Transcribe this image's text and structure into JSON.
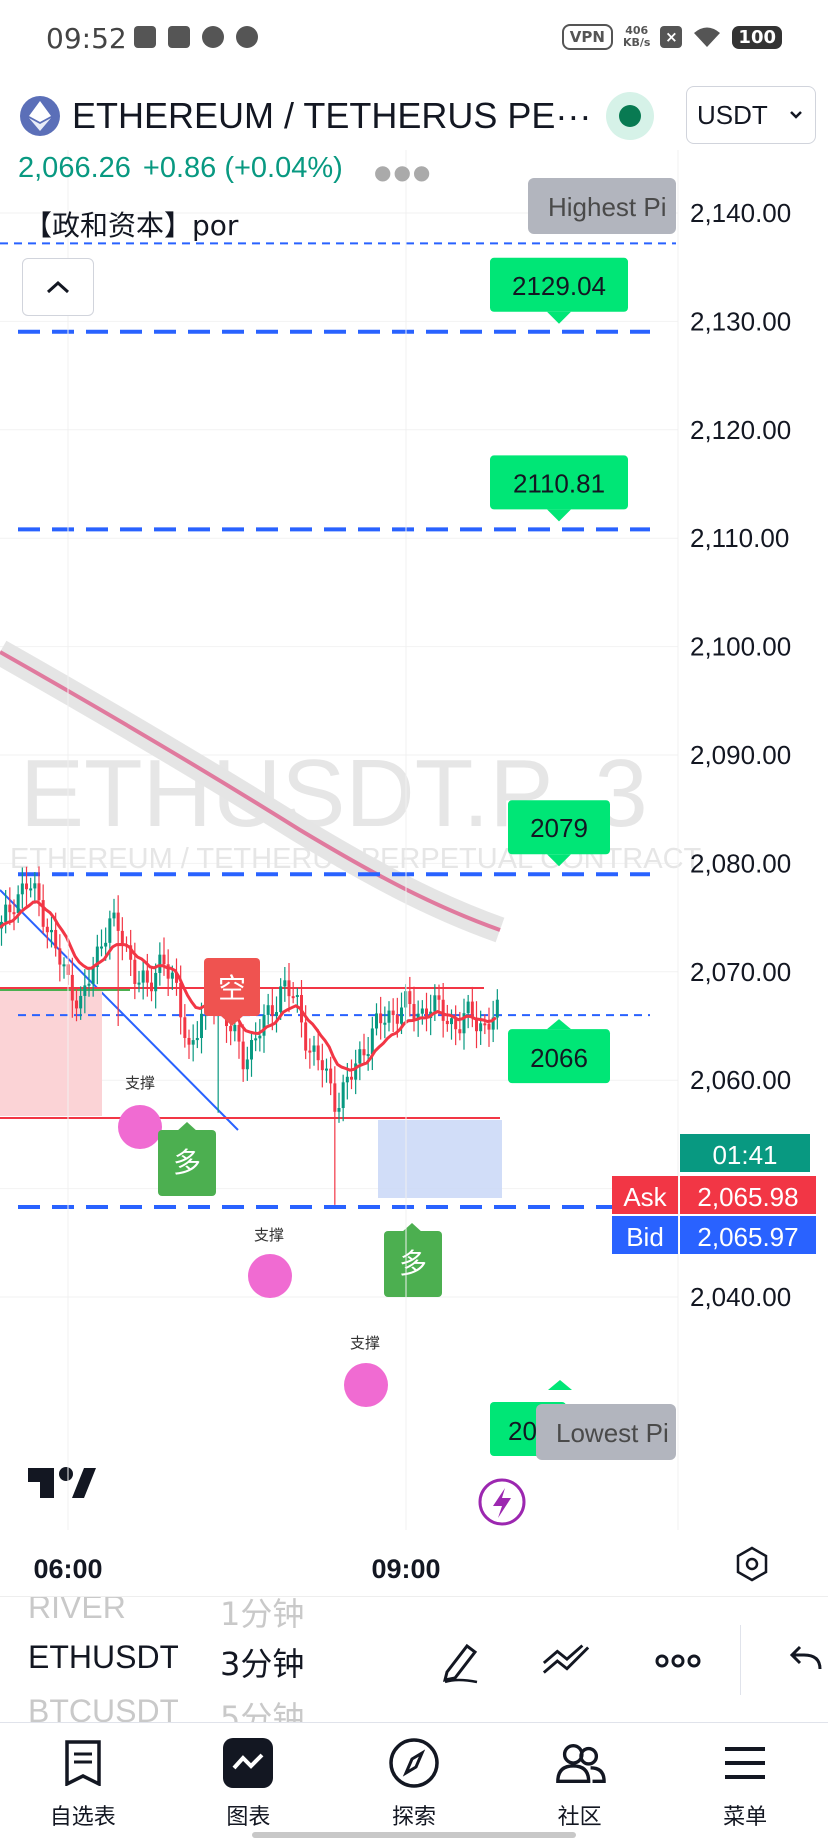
{
  "status_bar": {
    "time": "09:52",
    "vpn": "VPN",
    "net_speed_value": "406",
    "net_speed_unit": "KB/s",
    "battery": "100"
  },
  "header": {
    "symbol_title": "ETHEREUM / TETHERUS PE···",
    "currency": "USDT",
    "last_price": "2,066.26",
    "change": "+0.86 (+0.04%)",
    "indicator_label": "【政和资本】por"
  },
  "colors": {
    "up": "#089981",
    "down": "#f23645",
    "level_tag": "#00e676",
    "dashed_level": "#2962ff",
    "pink_marker": "#f06bd2",
    "long_tag": "#4caf50",
    "short_tag": "#ef5350"
  },
  "chart": {
    "watermark_symbol": "ETHUSDT.P, 3",
    "watermark_description": "ETHEREUM / TETHERUS PERPETUAL CONTRACT",
    "highest_label": "Highest Pi",
    "lowest_label": "Lowest Pi",
    "countdown": "01:41",
    "ask_label": "Ask",
    "ask_value": "2,065.98",
    "bid_label": "Bid",
    "bid_value": "2,065.97",
    "support_label": "支撑",
    "long_label": "多",
    "short_label": "空",
    "partial_low_tag": "20",
    "level_tags": [
      {
        "text": "2129.04",
        "value": 2129.04
      },
      {
        "text": "2110.81",
        "value": 2110.81
      },
      {
        "text": "2079",
        "value": 2079
      },
      {
        "text": "2066",
        "value": 2066
      }
    ],
    "time_labels": [
      "06:00",
      "09:00"
    ]
  },
  "chart_data": {
    "type": "candlestick",
    "title": "ETHUSDT.P, 3",
    "y_ticks": [
      2140,
      2130,
      2120,
      2110,
      2100,
      2090,
      2080,
      2070,
      2060,
      2050,
      2040
    ],
    "y_tick_labels": [
      "2,140.00",
      "2,130.00",
      "2,120.00",
      "2,110.00",
      "2,100.00",
      "2,090.00",
      "2,080.00",
      "2,070.00",
      "2,060.00",
      "2,050.00",
      "2,040.00"
    ],
    "ylim": [
      2038,
      2151
    ],
    "dashed_levels": [
      2137.2,
      2129.04,
      2110.81,
      2079,
      2066,
      2048.3
    ],
    "x_labels": [
      "06:00",
      "09:00"
    ],
    "close_path": [
      2074,
      2077,
      2078,
      2076,
      2072,
      2069,
      2067,
      2071,
      2075,
      2073,
      2070,
      2068,
      2072,
      2068,
      2063,
      2066,
      2068,
      2065,
      2062,
      2064,
      2066,
      2069,
      2067,
      2063,
      2061,
      2058,
      2060,
      2063,
      2065,
      2066,
      2067,
      2066,
      2067,
      2066,
      2065,
      2066,
      2065,
      2066
    ],
    "moving_average": [
      2100,
      2095,
      2091,
      2087,
      2084
    ]
  },
  "toolbar": {
    "symbols": [
      "RIVER",
      "ETHUSDT",
      "BTCUSDT"
    ],
    "intervals": [
      "1分钟",
      "3分钟",
      "5分钟"
    ]
  },
  "nav": {
    "watchlist": "自选表",
    "chart": "图表",
    "explore": "探索",
    "community": "社区",
    "menu": "菜单"
  }
}
